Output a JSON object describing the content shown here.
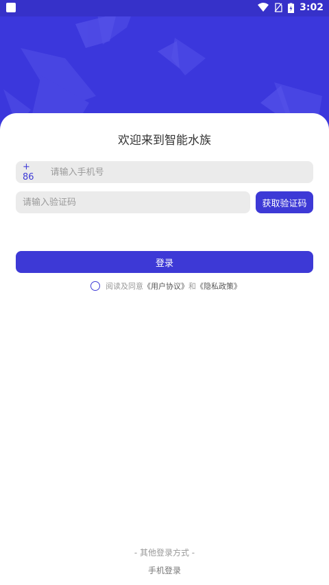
{
  "status_bar": {
    "time": "3:02",
    "icons": [
      "app-notification-icon",
      "wifi-icon",
      "no-sim-icon",
      "battery-charging-icon"
    ]
  },
  "colors": {
    "brand": "#3d39d6",
    "hero_bg": "#3b37dc",
    "field_bg": "#ebebeb"
  },
  "login": {
    "title": "欢迎来到智能水族",
    "country_code": "+ 86",
    "phone_placeholder": "请输入手机号",
    "code_placeholder": "请输入验证码",
    "get_code_label": "获取验证码",
    "login_label": "登录",
    "agreement": {
      "prefix": "阅读及同意",
      "user_agreement": "《用户协议》",
      "and": "和",
      "privacy_policy": "《隐私政策》"
    }
  },
  "other_login": {
    "title": "- 其他登录方式 -",
    "phone_login": "手机登录"
  }
}
